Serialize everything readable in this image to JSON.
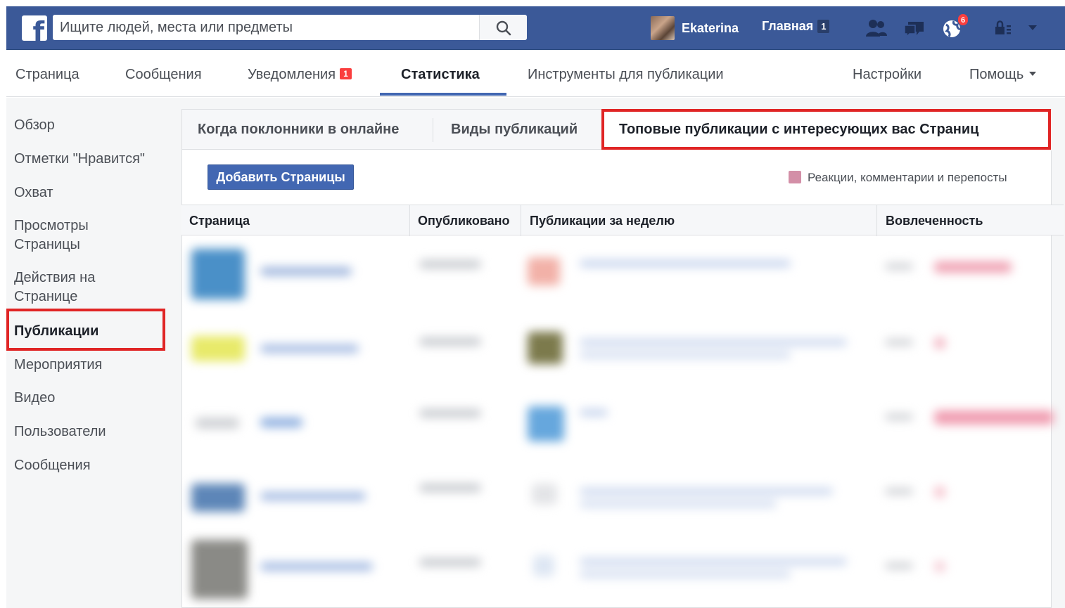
{
  "topbar": {
    "logo": "f",
    "search_placeholder": "Ищите людей, места или предметы",
    "user_name": "Ekaterina",
    "home_label": "Главная",
    "home_count": "1",
    "notifications_badge": "6",
    "brand_color": "#3b5998"
  },
  "page_nav": {
    "items": [
      {
        "label": "Страница"
      },
      {
        "label": "Сообщения"
      },
      {
        "label": "Уведомления",
        "badge": "1"
      },
      {
        "label": "Статистика",
        "active": true
      },
      {
        "label": "Инструменты для публикации"
      },
      {
        "label": "Настройки"
      },
      {
        "label": "Помощь"
      }
    ]
  },
  "sidebar": {
    "items": [
      {
        "label": "Обзор"
      },
      {
        "label": "Отметки \"Нравится\""
      },
      {
        "label": "Охват"
      },
      {
        "label": "Просмотры Страницы"
      },
      {
        "label": "Действия на Странице"
      },
      {
        "label": "Публикации",
        "active": true
      },
      {
        "label": "Мероприятия"
      },
      {
        "label": "Видео"
      },
      {
        "label": "Пользователи"
      },
      {
        "label": "Сообщения"
      }
    ]
  },
  "content": {
    "tabs": [
      {
        "label": "Когда поклонники в онлайне"
      },
      {
        "label": "Виды публикаций"
      },
      {
        "label": "Топовые публикации с интересующих вас Страниц",
        "active": true
      }
    ],
    "add_pages_button": "Добавить Страницы",
    "legend": {
      "label": "Реакции, комментарии и перепосты",
      "color": "#d38fa7"
    },
    "table": {
      "columns": [
        "Страница",
        "Опубликовано",
        "Публикации за неделю",
        "Вовлеченность"
      ]
    }
  },
  "highlight_color": "#e02525"
}
